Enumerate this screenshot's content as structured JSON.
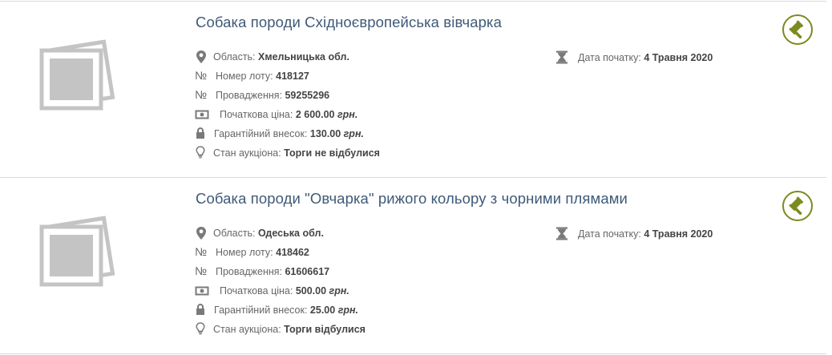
{
  "colors": {
    "title": "#3e5a78",
    "accent": "#7d8a1e",
    "label": "#666666",
    "value": "#444444",
    "divider": "#d9d9d9"
  },
  "lots": [
    {
      "title": "Собака породи Східноєвропейська вівчарка",
      "region_label": "Область:",
      "region_value": "Хмельницька обл.",
      "lot_number_label": "Номер лоту:",
      "lot_number_value": "418127",
      "proceeding_label": "Провадження:",
      "proceeding_value": "59255296",
      "start_price_label": "Початкова ціна:",
      "start_price_value": "2 600.00",
      "start_price_currency": "грн.",
      "deposit_label": "Гарантійний внесок:",
      "deposit_value": "130.00",
      "deposit_currency": "грн.",
      "status_label": "Стан аукціона:",
      "status_value": "Торги не відбулися",
      "start_date_label": "Дата початку:",
      "start_date_value": "4 Травня 2020",
      "icons": [
        "image-placeholder-icon",
        "map-marker-icon",
        "numero-icon",
        "banknote-icon",
        "lock-icon",
        "lightbulb-icon",
        "hourglass-icon",
        "gavel-icon"
      ]
    },
    {
      "title": "Собака породи \"Овчарка\" рижого кольору з чорними плямами",
      "region_label": "Область:",
      "region_value": "Одеська обл.",
      "lot_number_label": "Номер лоту:",
      "lot_number_value": "418462",
      "proceeding_label": "Провадження:",
      "proceeding_value": "61606617",
      "start_price_label": "Початкова ціна:",
      "start_price_value": "500.00",
      "start_price_currency": "грн.",
      "deposit_label": "Гарантійний внесок:",
      "deposit_value": "25.00",
      "deposit_currency": "грн.",
      "status_label": "Стан аукціона:",
      "status_value": "Торги відбулися",
      "start_date_label": "Дата початку:",
      "start_date_value": "4 Травня 2020",
      "icons": [
        "image-placeholder-icon",
        "map-marker-icon",
        "numero-icon",
        "banknote-icon",
        "lock-icon",
        "lightbulb-icon",
        "hourglass-icon",
        "gavel-icon"
      ]
    }
  ]
}
